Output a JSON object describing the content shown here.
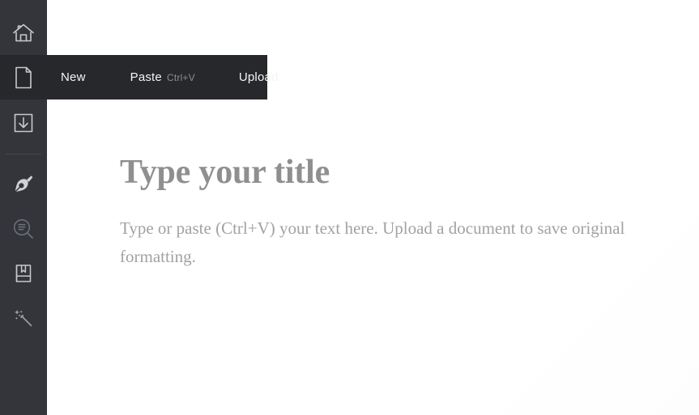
{
  "app": {
    "background_color": "#ffffff",
    "sidebar_color": "#33353b",
    "menubar_color": "#26282c",
    "icon_color": "#c6c8cc",
    "muted_text_color": "#8b8d92"
  },
  "sidebar": {
    "items": [
      {
        "name": "home",
        "icon": "home-icon",
        "label": "Home"
      },
      {
        "name": "document",
        "icon": "document-icon",
        "label": "Document"
      },
      {
        "name": "import",
        "icon": "download-box-icon",
        "label": "Import"
      },
      {
        "name": "write",
        "icon": "pen-nib-icon",
        "label": "Write"
      },
      {
        "name": "readability",
        "icon": "magnifier-lines-icon",
        "label": "Readability"
      },
      {
        "name": "dictionary",
        "icon": "book-bookmark-icon",
        "label": "Dictionary"
      },
      {
        "name": "suggestions",
        "icon": "magic-wand-icon",
        "label": "Suggestions"
      }
    ]
  },
  "menubar": {
    "icon": "document-icon",
    "actions": [
      {
        "id": "new",
        "label": "New",
        "shortcut": ""
      },
      {
        "id": "paste",
        "label": "Paste",
        "shortcut": "Ctrl+V"
      },
      {
        "id": "upload",
        "label": "Upload",
        "shortcut": ""
      }
    ]
  },
  "editor": {
    "title_placeholder": "Type your title",
    "body_placeholder": "Type or paste (Ctrl+V) your text here. Upload a document to save original formatting."
  }
}
